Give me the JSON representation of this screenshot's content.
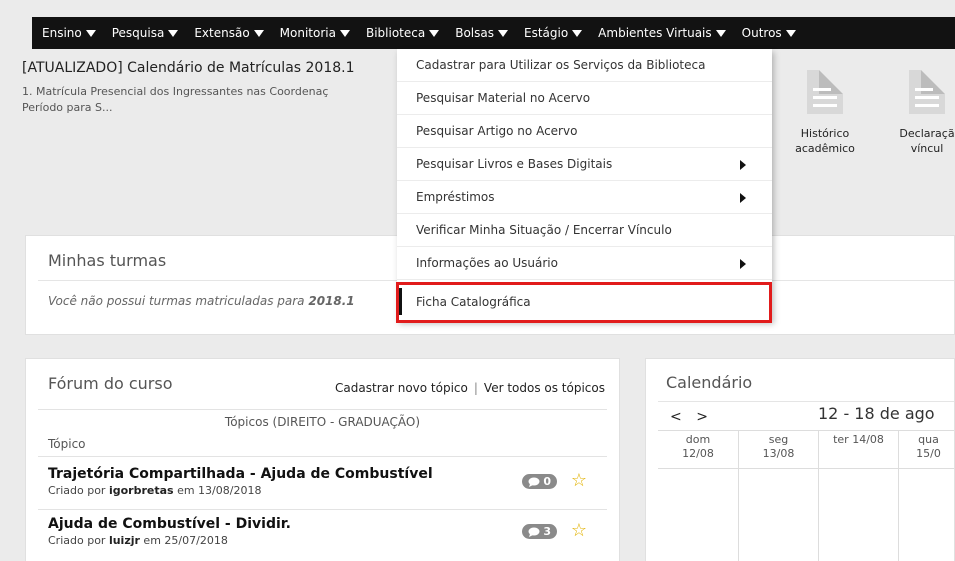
{
  "nav": {
    "items": [
      {
        "label": "Ensino"
      },
      {
        "label": "Pesquisa"
      },
      {
        "label": "Extensão"
      },
      {
        "label": "Monitoria"
      },
      {
        "label": "Biblioteca"
      },
      {
        "label": "Bolsas"
      },
      {
        "label": "Estágio"
      },
      {
        "label": "Ambientes Virtuais"
      },
      {
        "label": "Outros"
      }
    ]
  },
  "announcement": {
    "title": "[ATUALIZADO] Calendário de Matrículas 2018.1",
    "line1": "1. Matrícula Presencial dos Ingressantes nas Coordenaç",
    "line2": "Período para S..."
  },
  "documents": [
    {
      "line1": "Histórico",
      "line2": "acadêmico"
    },
    {
      "line1": "Declaraçã",
      "line2": "víncul"
    }
  ],
  "biblioteca_menu": {
    "items": [
      {
        "label": "Cadastrar para Utilizar os Serviços da Biblioteca",
        "submenu": false
      },
      {
        "label": "Pesquisar Material no Acervo",
        "submenu": false
      },
      {
        "label": "Pesquisar Artigo no Acervo",
        "submenu": false
      },
      {
        "label": "Pesquisar Livros e Bases Digitais",
        "submenu": true
      },
      {
        "label": "Empréstimos",
        "submenu": true
      },
      {
        "label": "Verificar Minha Situação / Encerrar Vínculo",
        "submenu": false
      },
      {
        "label": "Informações ao Usuário",
        "submenu": true
      },
      {
        "label": "Ficha Catalográfica",
        "submenu": false,
        "selected": true
      }
    ]
  },
  "turmas": {
    "title": "Minhas turmas",
    "message_prefix": "Você não possui turmas matriculadas para ",
    "message_period": "2018.1"
  },
  "forum": {
    "title": "Fórum do curso",
    "link_new": "Cadastrar novo tópico",
    "separator": "|",
    "link_all": "Ver todos os tópicos",
    "subtitle": "Tópicos (DIREITO - GRADUAÇÃO)",
    "column_header": "Tópico",
    "topics": [
      {
        "title": "Trajetória Compartilhada - Ajuda de Combustível",
        "meta_prefix": "Criado por ",
        "author": "igorbretas",
        "meta_suffix": " em 13/08/2018",
        "replies": "0"
      },
      {
        "title": "Ajuda de Combustível - Dividir.",
        "meta_prefix": "Criado por ",
        "author": "luizjr",
        "meta_suffix": " em 25/07/2018",
        "replies": "3"
      }
    ]
  },
  "calendar": {
    "title": "Calendário",
    "prev": "<",
    "next": ">",
    "range": "12 - 18 de ago",
    "days": [
      {
        "name": "dom",
        "date": "12/08"
      },
      {
        "name": "seg",
        "date": "13/08"
      },
      {
        "name": "ter 14/08",
        "date": ""
      },
      {
        "name": "qua",
        "date": "15/0"
      }
    ]
  },
  "colors": {
    "nav_bg": "#121212",
    "highlight": "#e11b1b",
    "star": "#e2b200"
  }
}
